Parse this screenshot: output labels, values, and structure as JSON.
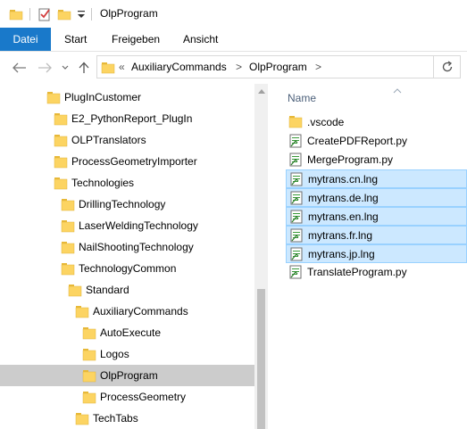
{
  "window": {
    "title": "OlpProgram"
  },
  "ribbon": {
    "tabs": [
      {
        "label": "Datei",
        "active": true
      },
      {
        "label": "Start",
        "active": false
      },
      {
        "label": "Freigeben",
        "active": false
      },
      {
        "label": "Ansicht",
        "active": false
      }
    ]
  },
  "address": {
    "overflow": "«",
    "crumbs": [
      "AuxiliaryCommands",
      "OlpProgram"
    ],
    "separator": ">"
  },
  "nav_tree": [
    {
      "label": "PlugInCustomer",
      "indent": 0,
      "selected": false
    },
    {
      "label": "E2_PythonReport_PlugIn",
      "indent": 1,
      "selected": false
    },
    {
      "label": "OLPTranslators",
      "indent": 1,
      "selected": false
    },
    {
      "label": "ProcessGeometryImporter",
      "indent": 1,
      "selected": false
    },
    {
      "label": "Technologies",
      "indent": 1,
      "selected": false
    },
    {
      "label": "DrillingTechnology",
      "indent": 2,
      "selected": false
    },
    {
      "label": "LaserWeldingTechnology",
      "indent": 2,
      "selected": false
    },
    {
      "label": "NailShootingTechnology",
      "indent": 2,
      "selected": false
    },
    {
      "label": "TechnologyCommon",
      "indent": 2,
      "selected": false
    },
    {
      "label": "Standard",
      "indent": 3,
      "selected": false
    },
    {
      "label": "AuxiliaryCommands",
      "indent": 4,
      "selected": false
    },
    {
      "label": "AutoExecute",
      "indent": 5,
      "selected": false
    },
    {
      "label": "Logos",
      "indent": 5,
      "selected": false
    },
    {
      "label": "OlpProgram",
      "indent": 5,
      "selected": true
    },
    {
      "label": "ProcessGeometry",
      "indent": 5,
      "selected": false
    },
    {
      "label": "TechTabs",
      "indent": 4,
      "selected": false
    }
  ],
  "files": {
    "column_header": "Name",
    "items": [
      {
        "name": ".vscode",
        "type": "folder",
        "selected": false
      },
      {
        "name": "CreatePDFReport.py",
        "type": "file",
        "selected": false
      },
      {
        "name": "MergeProgram.py",
        "type": "file",
        "selected": false
      },
      {
        "name": "mytrans.cn.lng",
        "type": "file",
        "selected": true
      },
      {
        "name": "mytrans.de.lng",
        "type": "file",
        "selected": true
      },
      {
        "name": "mytrans.en.lng",
        "type": "file",
        "selected": true
      },
      {
        "name": "mytrans.fr.lng",
        "type": "file",
        "selected": true
      },
      {
        "name": "mytrans.jp.lng",
        "type": "file",
        "selected": true
      },
      {
        "name": "TranslateProgram.py",
        "type": "file",
        "selected": false
      }
    ]
  },
  "colors": {
    "accent": "#1979ca",
    "selection_files": "#cce8ff",
    "selection_tree": "#cccccc"
  }
}
